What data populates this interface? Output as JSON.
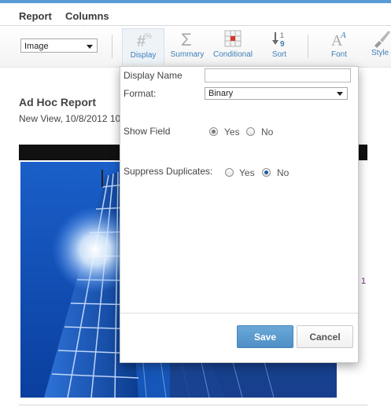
{
  "menu": {
    "tabs": [
      {
        "label": "Report"
      },
      {
        "label": "Columns"
      }
    ]
  },
  "toolbar": {
    "format_select": {
      "value": "Image"
    },
    "tools": [
      {
        "label": "Display",
        "icon": "display-icon",
        "active": true
      },
      {
        "label": "Summary",
        "icon": "sigma-icon"
      },
      {
        "label": "Conditional",
        "icon": "conditional-grid-icon"
      },
      {
        "label": "Sort",
        "icon": "sort-icon"
      },
      {
        "label": "Font",
        "icon": "font-icon"
      },
      {
        "label": "Style",
        "icon": "brush-icon"
      }
    ]
  },
  "report": {
    "title": "Ad Hoc Report",
    "subtitle": "New View, 10/8/2012 10",
    "side_number": "1"
  },
  "dialog": {
    "display_name_label": "Display Name",
    "display_name_value": "",
    "format_label": "Format:",
    "format_value": "Binary",
    "show_field_label": "Show Field",
    "show_field_yes": "Yes",
    "show_field_no": "No",
    "suppress_label": "Suppress Duplicates:",
    "suppress_yes": "Yes",
    "suppress_no": "No",
    "save_label": "Save",
    "cancel_label": "Cancel"
  },
  "colors": {
    "accent": "#5b9bd5",
    "tool_text": "#3f7fb8",
    "save_button": "#5a9bd0"
  }
}
